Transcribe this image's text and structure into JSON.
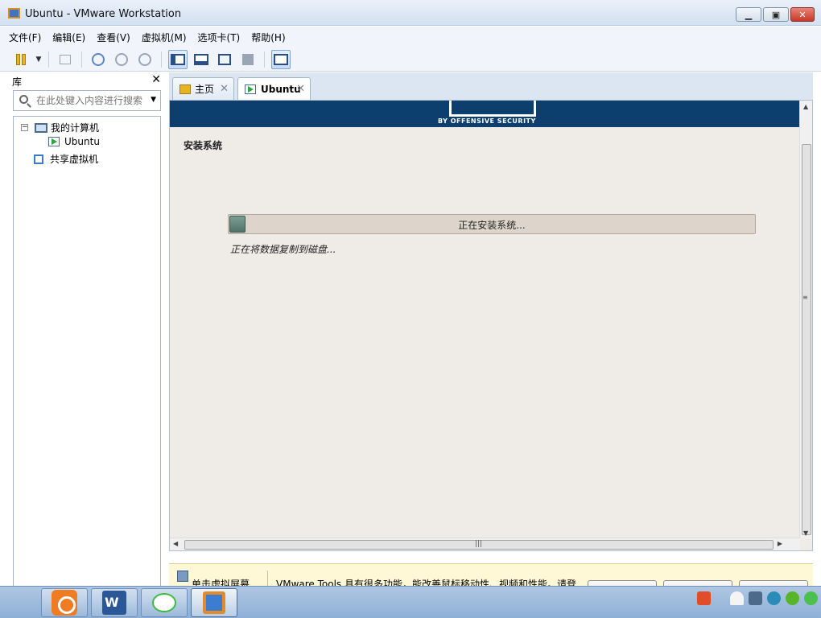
{
  "window": {
    "title": "Ubuntu - VMware Workstation",
    "controls": {
      "minimize": "▁",
      "maximize": "▣",
      "close": "✕"
    }
  },
  "menu": {
    "file": "文件(F)",
    "edit": "编辑(E)",
    "view": "查看(V)",
    "vm": "虚拟机(M)",
    "tabs": "选项卡(T)",
    "help": "帮助(H)"
  },
  "toolbar": {
    "icons": [
      "pause-icon",
      "dropdown-icon",
      "network-icon",
      "snapshot-take-icon",
      "snapshot-revert-icon",
      "snapshot-manager-icon",
      "console-view-icon",
      "thumbnail-view-icon",
      "fullscreen-icon",
      "unity-icon",
      "stretch-icon"
    ]
  },
  "library": {
    "title": "库",
    "close": "✕",
    "search_placeholder": "在此处键入内容进行搜索",
    "tree": {
      "expander": "−",
      "my_computer": "我的计算机",
      "vm_name": "Ubuntu",
      "shared_vms": "共享虚拟机"
    }
  },
  "tabs": {
    "home": "主页",
    "vm": "Ubuntu",
    "close_glyph": "✕"
  },
  "console": {
    "banner_tagline": "BY OFFENSIVE SECURITY",
    "section_title": "安装系统",
    "progress_label": "正在安装系统...",
    "progress_fraction": 0.03,
    "status": "正在将数据复制到磁盘..."
  },
  "hint_bar": {
    "text1": "单击虚拟屏幕",
    "text2": "VMware Tools 具有很多功能，能改善鼠标移动性、视频和性能。请登"
  },
  "colors": {
    "banner": "#0c3e6e",
    "console_bg": "#efebe7",
    "progress_fill": "#5b7d74",
    "hint_bg": "#fff8d6"
  }
}
